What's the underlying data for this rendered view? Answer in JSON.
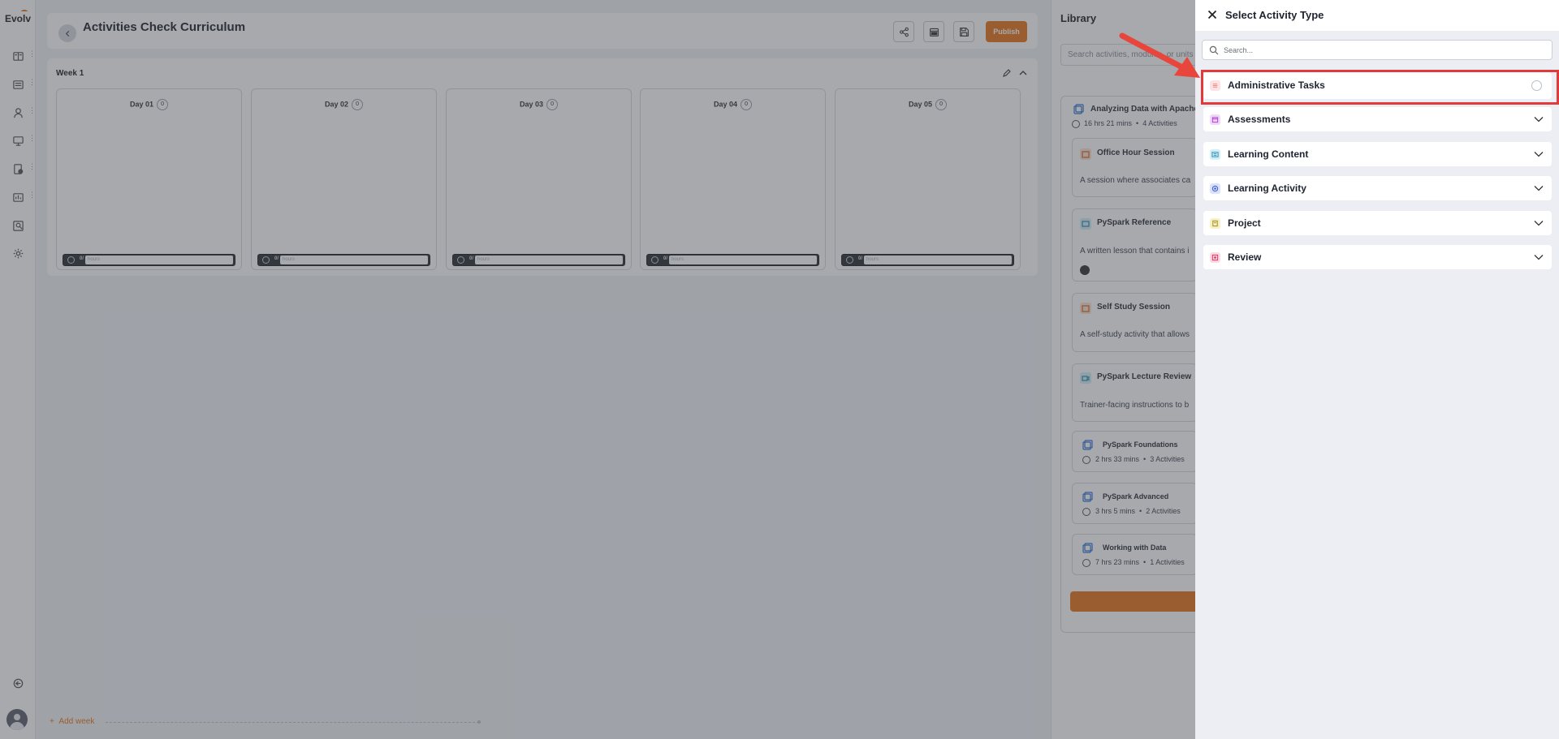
{
  "app": {
    "logo": "Evolv"
  },
  "header": {
    "title": "Activities Check Curriculum",
    "publish_label": "Publish"
  },
  "week": {
    "title": "Week 1",
    "days": [
      {
        "label": "Day 01",
        "count": "0",
        "time": "0/",
        "placeholder": "hours"
      },
      {
        "label": "Day 02",
        "count": "0",
        "time": "0/",
        "placeholder": "hours"
      },
      {
        "label": "Day 03",
        "count": "0",
        "time": "0/",
        "placeholder": "hours"
      },
      {
        "label": "Day 04",
        "count": "0",
        "time": "0/",
        "placeholder": "hours"
      },
      {
        "label": "Day 05",
        "count": "0",
        "time": "0/",
        "placeholder": "hours"
      }
    ]
  },
  "add_week_label": "Add week",
  "library": {
    "title": "Library",
    "search_placeholder": "Search activities, modules, or units",
    "series": [
      {
        "title": "Analyzing Data with Apache",
        "duration": "16 hrs 21 mins",
        "activities": "4 Activities"
      },
      {
        "title": "PySpark Foundations",
        "duration": "2 hrs 33 mins",
        "activities": "3 Activities"
      },
      {
        "title": "PySpark Advanced",
        "duration": "3 hrs 5 mins",
        "activities": "2 Activities"
      },
      {
        "title": "Working with Data",
        "duration": "7 hrs 23 mins",
        "activities": "1 Activities"
      }
    ],
    "activities": [
      {
        "title": "Office Hour Session",
        "description": "A session where associates ca"
      },
      {
        "title": "PySpark Reference",
        "description": "A written lesson that contains i"
      },
      {
        "title": "Self Study Session",
        "description": "A self-study activity that allows"
      },
      {
        "title": "PySpark Lecture Review",
        "description": "Trainer-facing instructions to b"
      }
    ]
  },
  "drawer": {
    "title": "Select Activity Type",
    "search_placeholder": "Search...",
    "types": [
      {
        "label": "Administrative Tasks",
        "icon": "list-icon",
        "color": "#f08a8a",
        "bg": "#fde3e3"
      },
      {
        "label": "Assessments",
        "icon": "calendar-icon",
        "color": "#b33fd6",
        "bg": "#f1d8f8"
      },
      {
        "label": "Learning Content",
        "icon": "id-card-icon",
        "color": "#2a8fb3",
        "bg": "#d3eef7"
      },
      {
        "label": "Learning Activity",
        "icon": "target-icon",
        "color": "#3a57d6",
        "bg": "#dbe2fb"
      },
      {
        "label": "Project",
        "icon": "clipboard-icon",
        "color": "#a38a12",
        "bg": "#f6f0c7"
      },
      {
        "label": "Review",
        "icon": "review-icon",
        "color": "#e0335f",
        "bg": "#fcdbe4"
      }
    ]
  },
  "colors": {
    "accent": "#e8761c",
    "highlight": "#e23a3a"
  }
}
